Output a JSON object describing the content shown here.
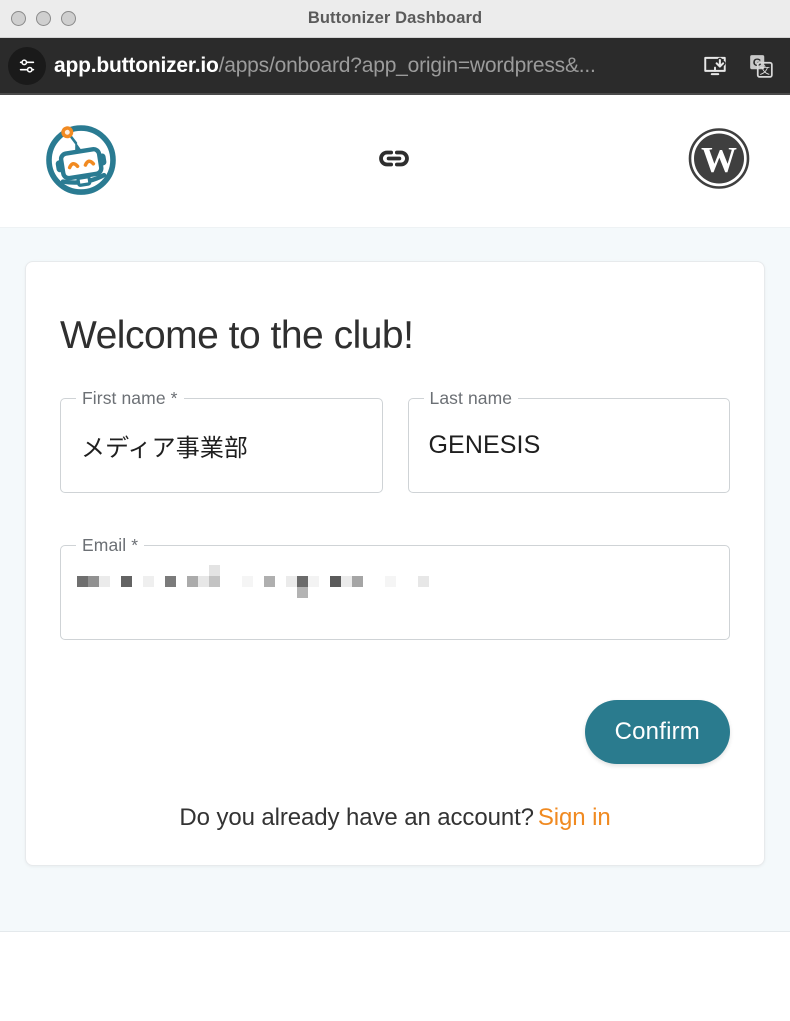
{
  "window": {
    "title": "Buttonizer Dashboard",
    "traffic_lights": [
      "close",
      "minimize",
      "zoom"
    ]
  },
  "browser": {
    "site_settings_icon": "tune-sliders-icon",
    "url_domain": "app.buttonizer.io",
    "url_path": "/apps/onboard?app_origin=wordpress&...",
    "install_icon": "install-app-icon",
    "translate_icon": "google-translate-icon"
  },
  "header": {
    "brand_icon": "buttonizer-robot-logo",
    "link_icon": "link-chain-icon",
    "wordpress_icon": "wordpress-logo",
    "colors": {
      "brand_teal": "#2a7b8e",
      "brand_orange": "#f08a21",
      "wordpress_gray": "#3f3f3f"
    }
  },
  "card": {
    "title": "Welcome to the club!",
    "fields": [
      {
        "label": "First name *",
        "value": "メディア事業部",
        "required": true,
        "redacted": false
      },
      {
        "label": "Last name",
        "value": "GENESIS",
        "required": false,
        "redacted": false
      },
      {
        "label": "Email *",
        "value": "",
        "required": true,
        "redacted": true
      }
    ],
    "confirm_label": "Confirm",
    "signin_prompt": "Do you already have an account?",
    "signin_label": "Sign in"
  }
}
